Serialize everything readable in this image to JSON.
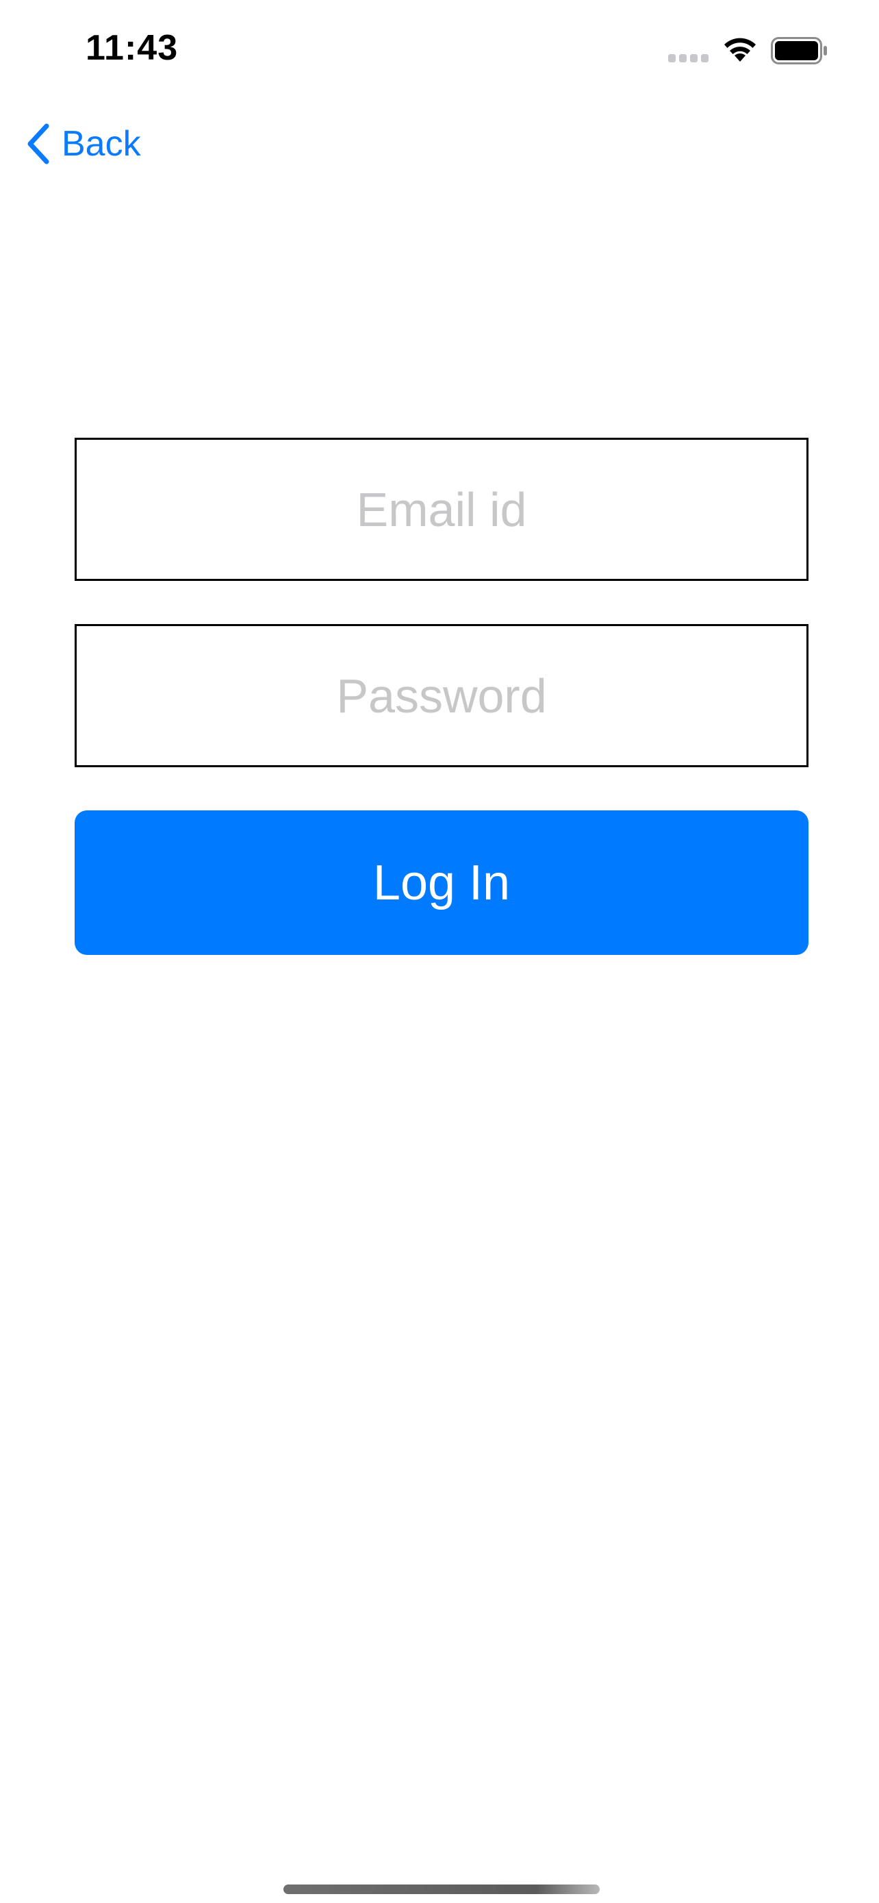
{
  "status_bar": {
    "time": "11:43"
  },
  "nav": {
    "back_label": "Back",
    "back_icon": "chevron-left-icon"
  },
  "form": {
    "email": {
      "value": "",
      "placeholder": "Email id"
    },
    "password": {
      "value": "",
      "placeholder": "Password"
    },
    "login_label": "Log In"
  },
  "colors": {
    "accent": "#007aff",
    "placeholder": "#c7c7c9",
    "field_border": "#000000"
  }
}
